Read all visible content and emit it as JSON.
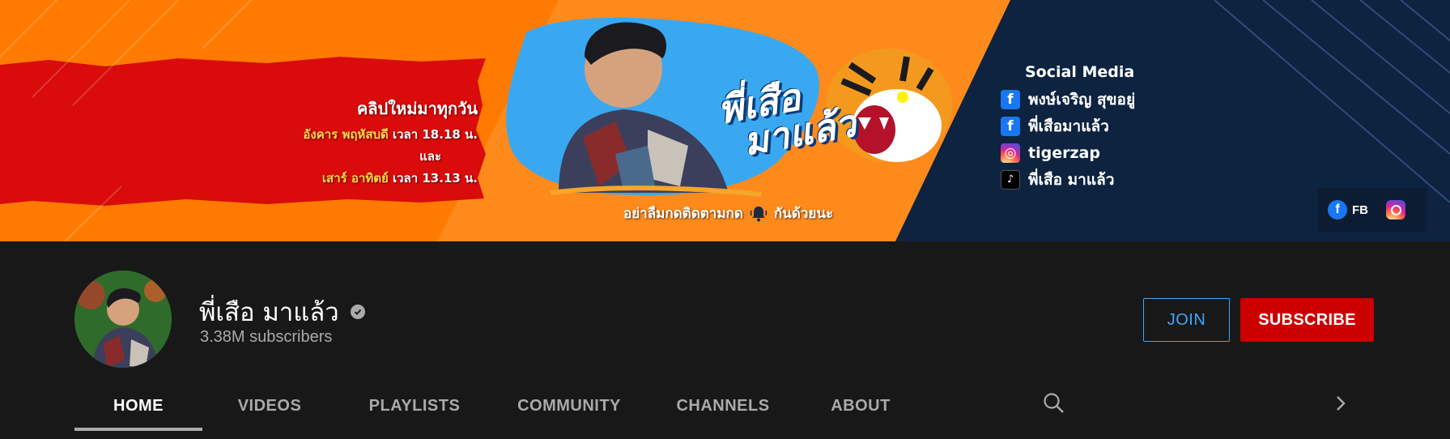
{
  "banner": {
    "promo": {
      "line1": "คลิปใหม่มาทุกวัน",
      "days1": "อังคาร พฤหัสบดี",
      "time1": "เวลา 18.18 น.",
      "and": "และ",
      "days2": "เสาร์ อาทิตย์",
      "time2": "เวลา 13.13 น."
    },
    "brand_line1": "พี่เสือ",
    "brand_line2": "มาแล้ว",
    "reminder_before": "อย่าลืมกดติดตามกด",
    "reminder_after": "กันด้วยนะ",
    "social": {
      "heading": "Social Media",
      "items": [
        {
          "icon": "facebook-icon",
          "label": "พงษ์เจริญ สุขอยู่"
        },
        {
          "icon": "facebook-icon",
          "label": "พี่เสือมาแล้ว"
        },
        {
          "icon": "instagram-icon",
          "label": "tigerzap"
        },
        {
          "icon": "tiktok-icon",
          "label": "พี่เสือ มาแล้ว"
        }
      ]
    },
    "links": {
      "fb_label": "FB"
    }
  },
  "channel": {
    "name": "พี่เสือ มาแล้ว",
    "subscribers": "3.38M subscribers",
    "join_label": "JOIN",
    "subscribe_label": "SUBSCRIBE"
  },
  "tabs": [
    {
      "label": "HOME",
      "active": true
    },
    {
      "label": "VIDEOS",
      "active": false
    },
    {
      "label": "PLAYLISTS",
      "active": false
    },
    {
      "label": "COMMUNITY",
      "active": false
    },
    {
      "label": "CHANNELS",
      "active": false
    },
    {
      "label": "ABOUT",
      "active": false
    }
  ],
  "colors": {
    "background": "#181818",
    "subscribe": "#cc0000",
    "join": "#3ea6ff",
    "banner_orange": "#ff8a1c",
    "banner_navy": "#0d2340"
  }
}
